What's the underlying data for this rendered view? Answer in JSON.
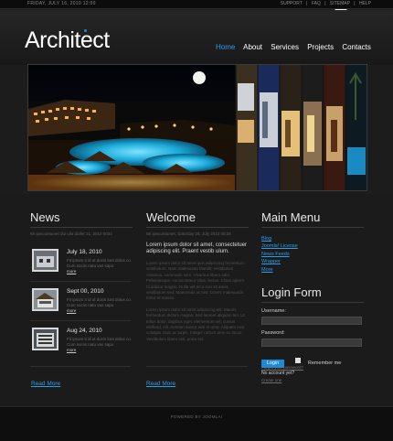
{
  "topbar": {
    "date": "FRIDAY, JULY 16, 2010 12:00",
    "links": [
      "SUPPORT",
      "|",
      "FAQ",
      "|",
      "SITEMAP",
      "|",
      "HELP"
    ]
  },
  "logo": "Architect",
  "nav": [
    {
      "label": "Home",
      "active": true
    },
    {
      "label": "About",
      "active": false
    },
    {
      "label": "Services",
      "active": false
    },
    {
      "label": "Projects",
      "active": false
    },
    {
      "label": "Contacts",
      "active": false
    }
  ],
  "news": {
    "title": "News",
    "intro": "Wi ipiscuntumet dui ulla duifer 21, 2010 0034",
    "items": [
      {
        "date": "July 18, 2010",
        "text": "Fit ipsum it id ut ducis lunt dolus co. Cum sociis natu vas sapo",
        "more": "more"
      },
      {
        "date": "Sept 00, 2010",
        "text": "Fit ipsum it id ut ducis lunt dolus co. Cum sociis natu vas sapo",
        "more": "more"
      },
      {
        "date": "Aug 24, 2010",
        "text": "Fit ipsum it id ut ducis lunt dolus co. Cum sociis natu vas sapo",
        "more": "more"
      }
    ],
    "read_more": "Read More"
  },
  "welcome": {
    "title": "Welcome",
    "intro": "Wi ipiscuntumet, Saturday 26, July 2010 00:34",
    "lead": "Lorem ipsum dolor sit amet, consectetuer adipiscing elit. Praent vestib ulum.",
    "para1": "Lorem ipsum dolor sit amet quis adipiscing fermentum vestibulum. Nam malesuada blandit, vestibulum Vivamus, commodo sem. Vivamus libero odio. Pellentesque, consecteteur vitae, lectus. Class aptent. Curabitur magna. Nulla vel arcu non sit amet, vestibulum sed. Maecenas ac nisl. Donec malesuada tortor et massa.",
    "para2": "Lorem ipsum dolor sit amet adipiscing elit. Mauris fermentum dictum magna. Sed laoreet aliquam leo. Ut tellus dolor, dapibus eget, elementum vel, cursus eleifend, elit. Aenean auctor wisi et urna. Aliquam erat volutpat. Duis ac turpis. Integer rutrum ante eu lacus. Vestibulum libero nisl, porta vel.",
    "read_more": "Read More"
  },
  "menu": {
    "title": "Main Menu",
    "links": [
      "Blog",
      "Joomla! License",
      "News Feeds",
      "Wrapper",
      "More"
    ]
  },
  "login": {
    "title": "Login Form",
    "username_label": "Username:",
    "password_label": "Password:",
    "button": "Login",
    "remember": "Remember me",
    "forgot": "Forgot your password?",
    "no_account": "No account yet?",
    "create": "Create one"
  },
  "footer": "POWERED BY JOOMLA!",
  "colors": {
    "accent": "#2a9ee8",
    "background": "#1c1c1c"
  }
}
